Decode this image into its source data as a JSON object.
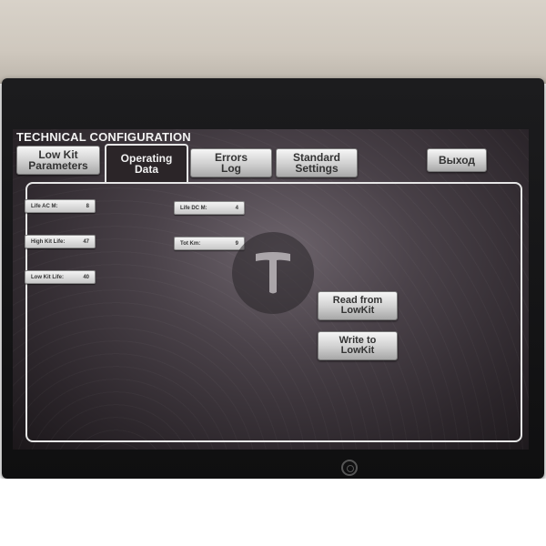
{
  "title": "TECHNICAL CONFIGURATION",
  "tabs": [
    {
      "label": "Low Kit\nParameters",
      "active": false
    },
    {
      "label": "Operating\nData",
      "active": true
    },
    {
      "label": "Errors\nLog",
      "active": false
    },
    {
      "label": "Standard\nSettings",
      "active": false
    }
  ],
  "exit_label": "Выход",
  "fields": {
    "life_ac": {
      "label": "Life AC M:",
      "value": "8"
    },
    "high_kit_life": {
      "label": "High Kit Life:",
      "value": "47"
    },
    "low_kit_life": {
      "label": "Low Kit Life:",
      "value": "40"
    },
    "life_dc": {
      "label": "Life DC M:",
      "value": "4"
    },
    "tot_km": {
      "label": "Tot Km:",
      "value": "9"
    }
  },
  "buttons": {
    "read": "Read from\nLowKit",
    "write": "Write to\nLowKit"
  },
  "colors": {
    "screen_bg": "#4a4249",
    "accent_border": "#e6e6e6",
    "button_face": "#cfcfcf"
  }
}
